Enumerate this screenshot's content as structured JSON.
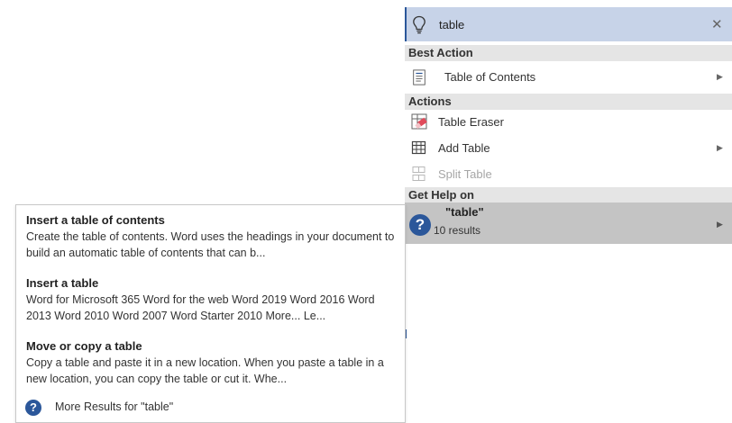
{
  "search": {
    "query": "table",
    "close_glyph": "✕"
  },
  "best_action": {
    "header": "Best Action",
    "items": [
      {
        "label": "Table of Contents",
        "icon": "document-toc-icon",
        "has_submenu": true
      }
    ]
  },
  "actions": {
    "header": "Actions",
    "items": [
      {
        "label": "Table Eraser",
        "icon": "table-eraser-icon",
        "has_submenu": false,
        "enabled": true
      },
      {
        "label": "Add Table",
        "icon": "table-grid-icon",
        "has_submenu": true,
        "enabled": true
      },
      {
        "label": "Split Table",
        "icon": "split-table-icon",
        "has_submenu": false,
        "enabled": false
      }
    ]
  },
  "get_help": {
    "header": "Get Help on",
    "term": "\"table\"",
    "count": "10 results",
    "icon_glyph": "?"
  },
  "help_results": [
    {
      "title": "Insert a table of contents",
      "description": "Create the table of contents. Word uses the headings in your document to build an automatic table of contents that can b..."
    },
    {
      "title": "Insert a table",
      "description": "Word for Microsoft 365 Word for the web Word 2019 Word 2016 Word 2013 Word 2010 Word 2007 Word Starter 2010 More... Le..."
    },
    {
      "title": "Move or copy a table",
      "description": "Copy a table and paste it in a new location. When you paste a table in a new location, you can copy the table or cut it. Whe..."
    }
  ],
  "more_results": {
    "label": "More Results for \"table\"",
    "icon_glyph": "?"
  },
  "colors": {
    "accent": "#2b579a",
    "search_bg": "#c7d3e8",
    "section_bg": "#e5e5e5",
    "selected_bg": "#c4c4c4"
  }
}
